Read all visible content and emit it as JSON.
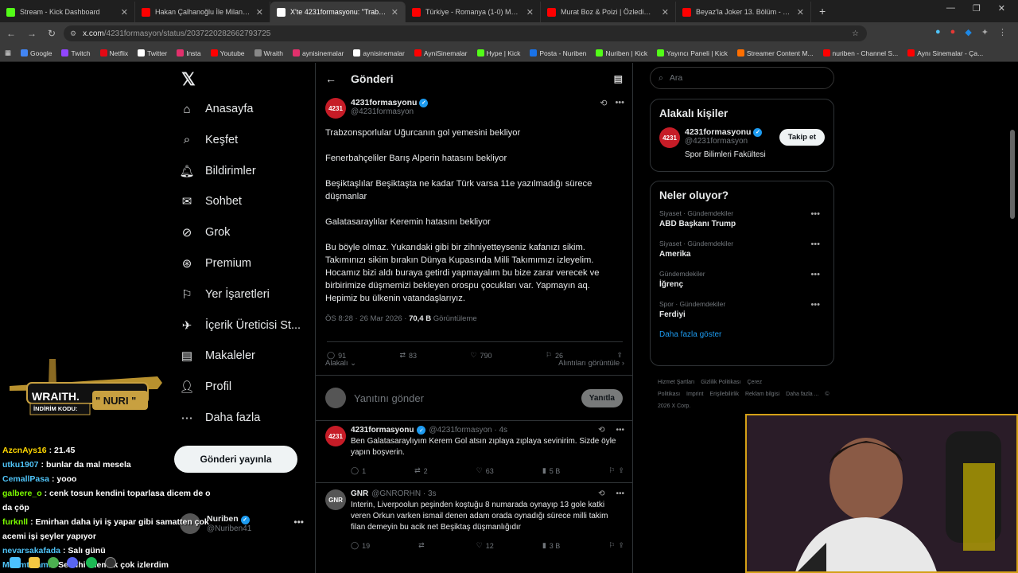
{
  "tabs": [
    {
      "title": "Stream - Kick Dashboard",
      "color": "#53fc18",
      "active": false
    },
    {
      "title": "Hakan Çalhanoğlu İle Milano'da...",
      "color": "#ff0000",
      "active": false
    },
    {
      "title": "X'te 4231formasyonu: \"Trabzon...",
      "color": "#ffffff",
      "active": true
    },
    {
      "title": "Türkiye - Romanya (1-0) Maç Ö...",
      "color": "#ff0000",
      "active": false
    },
    {
      "title": "Murat Boz & Poizi | Özledim | R...",
      "color": "#ff0000",
      "active": false
    },
    {
      "title": "Beyaz'la Joker 13. Bölüm - YouT...",
      "color": "#ff0000",
      "active": false
    }
  ],
  "url": {
    "host": "x.com",
    "path": "/4231formasyon/status/2037220282662793725"
  },
  "bookmarks": [
    {
      "label": "Google",
      "color": "#4285f4"
    },
    {
      "label": "Twitch",
      "color": "#9146ff"
    },
    {
      "label": "Netflix",
      "color": "#e50914"
    },
    {
      "label": "Twitter",
      "color": "#ffffff"
    },
    {
      "label": "Insta",
      "color": "#e1306c"
    },
    {
      "label": "Youtube",
      "color": "#ff0000"
    },
    {
      "label": "Wraith",
      "color": "#888888"
    },
    {
      "label": "aynisinemalar",
      "color": "#e1306c"
    },
    {
      "label": "aynisinemalar",
      "color": "#ffffff"
    },
    {
      "label": "AyniSinemalar",
      "color": "#ff0000"
    },
    {
      "label": "Hype | Kick",
      "color": "#53fc18"
    },
    {
      "label": "Posta - Nuriben",
      "color": "#1a73e8"
    },
    {
      "label": "Nuriben | Kick",
      "color": "#53fc18"
    },
    {
      "label": "Yayıncı Paneli | Kick",
      "color": "#53fc18"
    },
    {
      "label": "Streamer Content M...",
      "color": "#ff6f00"
    },
    {
      "label": "nuriben - Channel S...",
      "color": "#ff0000"
    },
    {
      "label": "Aynı Sinemalar - Ça...",
      "color": "#ff0000"
    }
  ],
  "nav": {
    "items": [
      "Anasayfa",
      "Keşfet",
      "Bildirimler",
      "Sohbet",
      "Grok",
      "Premium",
      "Yer İşaretleri",
      "İçerik Üreticisi St...",
      "Makaleler",
      "Profil",
      "Daha fazla"
    ],
    "post_button": "Gönderi yayınla",
    "account": {
      "name": "Nuriben",
      "handle": "@Nuriben41"
    }
  },
  "header": {
    "title": "Gönderi"
  },
  "tweet": {
    "avatar_text": "4231",
    "name": "4231formasyonu",
    "handle": "@4231formasyon",
    "paragraphs": [
      "Trabzonsporlular Uğurcanın gol yemesini bekliyor",
      "Fenerbahçeliler Barış Alperin hatasını bekliyor",
      "Beşiktaşlılar Beşiktaşta ne kadar Türk varsa 11e yazılmadığı sürece düşmanlar",
      "Galatasaraylılar Keremin hatasını bekliyor",
      "Bu böyle olmaz. Yukarıdaki gibi bir zihniyetteyseniz kafanızı sikim. Takımınızı sikim bırakın Dünya Kupasında Milli Takımımızı izleyelim. Hocamız bizi aldı buraya getirdi yapmayalım bu bize zarar verecek ve birbirimize düşmemizi bekleyen orospu çocukları var. Yapmayın aq. Hepimiz bu ülkenin vatandaşlarıyız."
    ],
    "time": "ÖS 8:28 · 26 Mar 2026 · ",
    "views": "70,4 B",
    "views_label": " Görüntüleme",
    "replies": "91",
    "retweets": "83",
    "likes": "790",
    "bookmarks": "26",
    "sort_label": "Alakalı",
    "quotes_label": "Alıntıları görüntüle"
  },
  "reply_box": {
    "placeholder": "Yanıtını gönder",
    "button": "Yanıtla"
  },
  "replies": [
    {
      "avatar_text": "4231",
      "name": "4231formasyonu",
      "handle": "@4231formasyon · 4s",
      "text": "Ben Galatasaraylıyım Kerem Gol atsın zıplaya zıplaya sevinirim. Sizde öyle yapın boşverin.",
      "replies": "1",
      "retweets": "2",
      "likes": "63",
      "views": "5 B"
    },
    {
      "avatar_text": "GNR",
      "name": "GNR",
      "handle": "@GNRORHN · 3s",
      "text": "Interin, Liverpoolun peşinden koştuğu 8 numarada oynayıp 13 gole katki veren Orkun varken ismail denen adam orada oynadığı sürece milli takim filan demeyin bu acik net Beşiktaş düşmanlığıdır",
      "replies": "19",
      "retweets": "",
      "likes": "12",
      "views": "3 B"
    }
  ],
  "right": {
    "search_placeholder": "Ara",
    "relevant_title": "Alakalı kişiler",
    "person": {
      "name": "4231formasyonu",
      "handle": "@4231formasyon",
      "bio": "Spor Bilimleri Fakültesi",
      "follow": "Takip et"
    },
    "trends_title": "Neler oluyor?",
    "trends": [
      {
        "category": "Siyaset · Gündemdekiler",
        "name": "ABD Başkanı Trump"
      },
      {
        "category": "Siyaset · Gündemdekiler",
        "name": "Amerika"
      },
      {
        "category": "Gündemdekiler",
        "name": "İğrenç"
      },
      {
        "category": "Spor · Gündemdekiler",
        "name": "Ferdiyi"
      }
    ],
    "show_more": "Daha fazla göster",
    "footer": [
      "Hizmet Şartları",
      "Gizlilik Politikası",
      "Çerez Politikası",
      "Imprint",
      "Erişilebilirlik",
      "Reklam bilgisi",
      "Daha fazla ...",
      "© 2026 X Corp."
    ]
  },
  "overlay": {
    "brand": "WRAITH.",
    "code_label": "İNDİRİM KODU:",
    "code": "\" NURI \"",
    "chat": [
      {
        "user": "AzcnAys16",
        "color": "#ffd700",
        "msg": ": 21.45"
      },
      {
        "user": "utku1907",
        "color": "#4fc3f7",
        "msg": ": bunlar da mal mesela"
      },
      {
        "user": "CemallPasa",
        "color": "#4fc3f7",
        "msg": ": yooo"
      },
      {
        "user": "galbere_o",
        "color": "#7cfc00",
        "msg": ": cenk tosun kendini toparlasa dicem de o da çöp"
      },
      {
        "user": "furknll",
        "color": "#7cfc00",
        "msg": ": Emirhan daha iyi iş yapar gibi samatten çok acemi işi şeyler yapıyor"
      },
      {
        "user": "nevarsakafada",
        "color": "#4fc3f7",
        "msg": ": Salı günü"
      },
      {
        "user": "MehmtMami",
        "color": "#4fc3f7",
        "msg": ": Semihi izlemek çok izlerdim"
      }
    ]
  }
}
